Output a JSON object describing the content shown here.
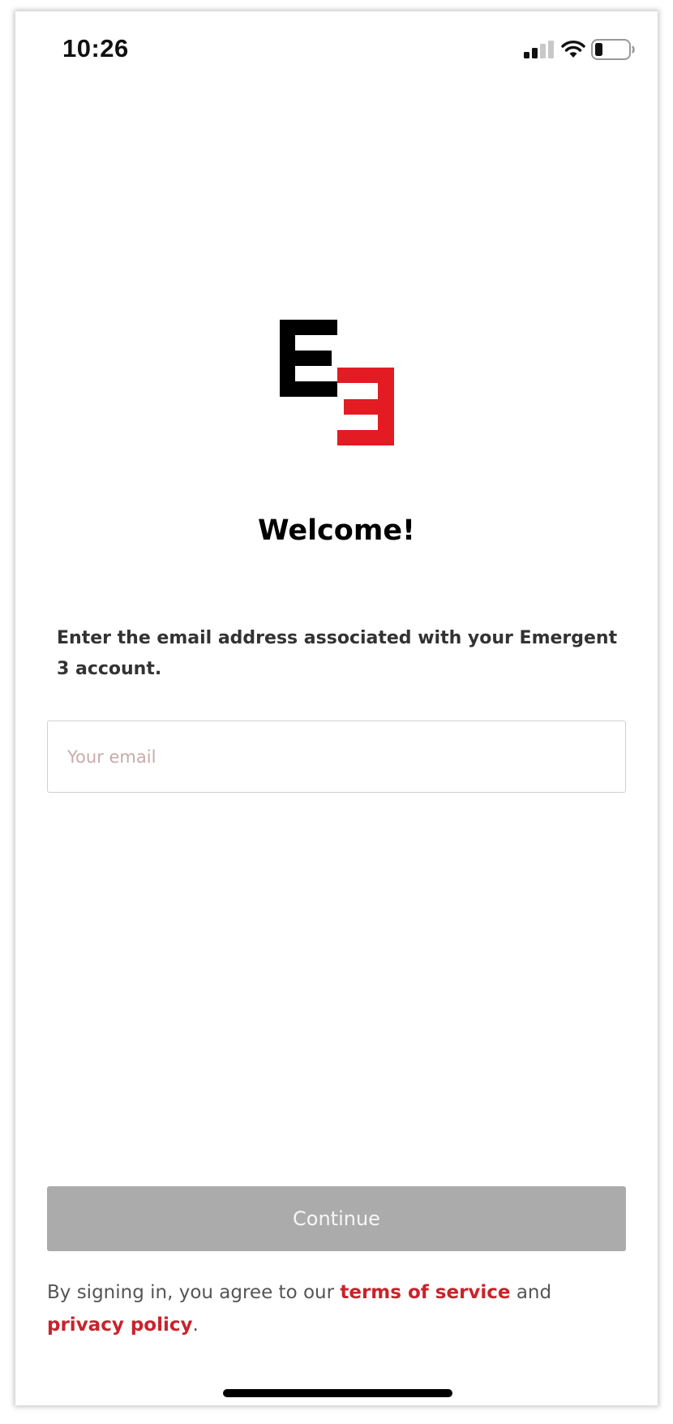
{
  "status_bar": {
    "time": "10:26",
    "icons": [
      "cellular-signal-icon",
      "wifi-icon",
      "battery-icon"
    ]
  },
  "logo": {
    "name": "Emergent 3 logo",
    "colors": {
      "e_black": "#000000",
      "three_red": "#e31b23"
    }
  },
  "welcome": {
    "title": "Welcome!",
    "instructions": "Enter the email address associated with your Emergent 3 account."
  },
  "email": {
    "value": "",
    "placeholder": "Your email"
  },
  "actions": {
    "continue_label": "Continue",
    "continue_enabled": false
  },
  "legal": {
    "prefix": "By signing in, you agree to our ",
    "terms_label": "terms of service",
    "middle": " and ",
    "privacy_label": "privacy policy",
    "suffix": "."
  },
  "colors": {
    "link": "#c9232b",
    "button_disabled": "#ababab",
    "placeholder": "#c9aaaa"
  }
}
